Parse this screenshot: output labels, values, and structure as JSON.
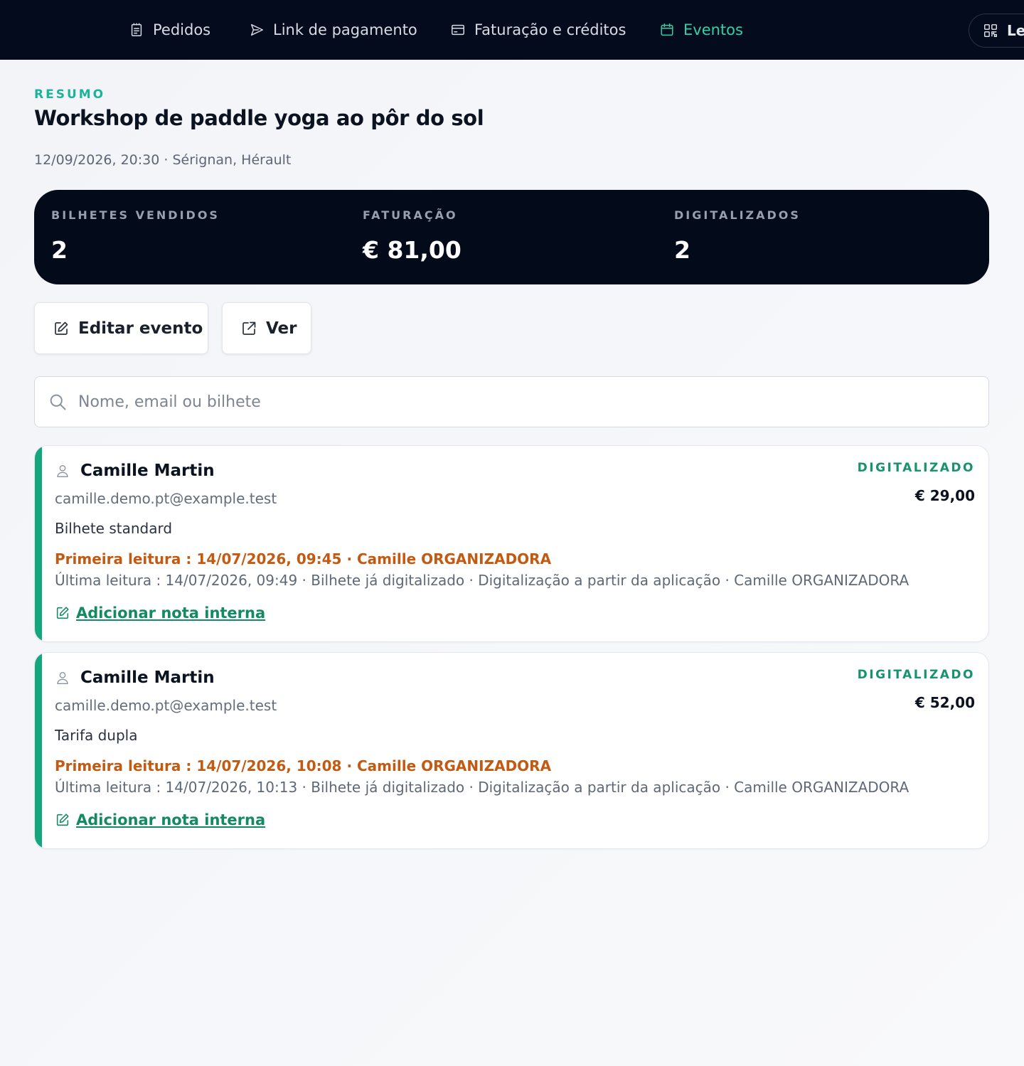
{
  "nav": {
    "items": [
      {
        "label": "Pedidos",
        "icon": "receipt-icon"
      },
      {
        "label": "Link de pagamento",
        "icon": "send-icon"
      },
      {
        "label": "Faturação e créditos",
        "icon": "credit-card-icon"
      },
      {
        "label": "Eventos",
        "icon": "calendar-icon",
        "active": true
      }
    ],
    "pill_label": "Le",
    "pill_icon": "qr-code-icon"
  },
  "header": {
    "eyebrow": "RESUMO",
    "title": "Workshop de paddle yoga ao pôr do sol",
    "meta": "12/09/2026, 20:30 · Sérignan, Hérault"
  },
  "stats": [
    {
      "label": "BILHETES VENDIDOS",
      "value": "2"
    },
    {
      "label": "FATURAÇÃO",
      "value": "€ 81,00"
    },
    {
      "label": "DIGITALIZADOS",
      "value": "2"
    }
  ],
  "actions": {
    "edit_label": "Editar evento",
    "view_label": "Ver"
  },
  "search": {
    "placeholder": "Nome, email ou bilhete",
    "value": ""
  },
  "tickets": [
    {
      "name": "Camille Martin",
      "email": "camille.demo.pt@example.test",
      "ticket_type": "Bilhete standard",
      "first_scan": "Primeira leitura : 14/07/2026, 09:45 · Camille ORGANIZADORA",
      "last_scan": "Última leitura : 14/07/2026, 09:49 · Bilhete já digitalizado · Digitalização a partir da aplicação · Camille ORGANIZADORA",
      "note_label": "Adicionar nota interna",
      "status": "DIGITALIZADO",
      "price": "€ 29,00"
    },
    {
      "name": "Camille Martin",
      "email": "camille.demo.pt@example.test",
      "ticket_type": "Tarifa dupla",
      "first_scan": "Primeira leitura : 14/07/2026, 10:08 · Camille ORGANIZADORA",
      "last_scan": "Última leitura : 14/07/2026, 10:13 · Bilhete já digitalizado · Digitalização a partir da aplicação · Camille ORGANIZADORA",
      "note_label": "Adicionar nota interna",
      "status": "DIGITALIZADO",
      "price": "€ 52,00"
    }
  ],
  "colors": {
    "nav_bg": "#040b1c",
    "accent_green": "#14a77e",
    "active_nav": "#2fd2a6",
    "first_scan_orange": "#c25a12"
  }
}
